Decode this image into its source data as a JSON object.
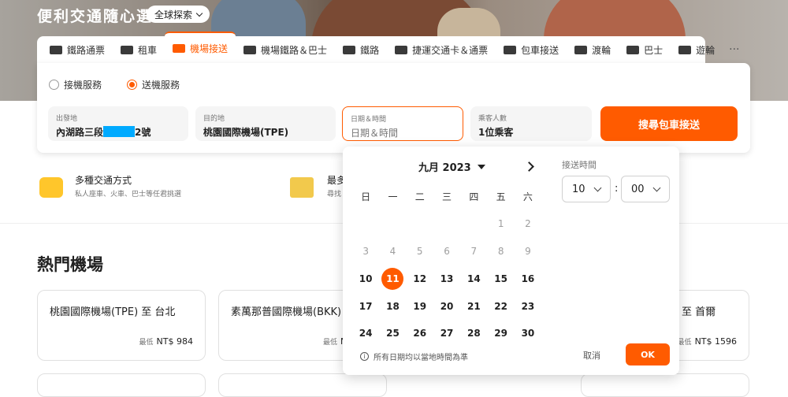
{
  "header": {
    "title": "便利交通隨心選",
    "explore_label": "全球探索"
  },
  "tabs": [
    {
      "label": "鐵路通票",
      "icon": "train-icon"
    },
    {
      "label": "租車",
      "icon": "car-icon"
    },
    {
      "label": "機場接送",
      "icon": "airport-transfer-icon",
      "active": true
    },
    {
      "label": "機場鐵路＆巴士",
      "icon": "airport-rail-icon"
    },
    {
      "label": "鐵路",
      "icon": "rail-icon"
    },
    {
      "label": "捷運交通卡＆通票",
      "icon": "metro-card-icon"
    },
    {
      "label": "包車接送",
      "icon": "charter-icon"
    },
    {
      "label": "渡輪",
      "icon": "ferry-icon"
    },
    {
      "label": "巴士",
      "icon": "bus-icon"
    },
    {
      "label": "遊輪",
      "icon": "cruise-icon"
    },
    {
      "label": "···",
      "icon": "more-icon"
    }
  ],
  "search": {
    "pickup_label": "接機服務",
    "dropoff_label": "送機服務",
    "selected_service": "送機服務",
    "from_label": "出發地",
    "from_value_prefix": "內湖路三段",
    "from_value_suffix": "2號",
    "to_label": "目的地",
    "to_value": "桃園國際機場(TPE)",
    "datetime_label": "日期＆時間",
    "datetime_placeholder": "日期＆時間",
    "passengers_label": "乘客人數",
    "passengers_value": "1位乘客",
    "search_button": "搜尋包車接送"
  },
  "features": [
    {
      "title": "多種交通方式",
      "subtitle": "私人座車、火車、巴士等任君挑選"
    },
    {
      "title": "最多",
      "subtitle": "尋找"
    }
  ],
  "popular": {
    "title": "熱門機場",
    "cards": [
      {
        "title": "桃園國際機場(TPE) 至 台北",
        "min_label": "最低",
        "price": "NT$ 984"
      },
      {
        "title": "素萬那普國際機場(BKK) 至",
        "min_label": "最低",
        "price": "N"
      },
      {
        "title": "至 首爾",
        "min_label": "最低",
        "price": "NT$ 1596"
      }
    ]
  },
  "calendar": {
    "month_label": "九月 2023",
    "weekdays": [
      "日",
      "一",
      "二",
      "三",
      "四",
      "五",
      "六"
    ],
    "leading_blanks": 5,
    "days": [
      "1",
      "2",
      "3",
      "4",
      "5",
      "6",
      "7",
      "8",
      "9",
      "10",
      "11",
      "12",
      "13",
      "14",
      "15",
      "16",
      "17",
      "18",
      "19",
      "20",
      "21",
      "22",
      "23",
      "24",
      "25",
      "26",
      "27",
      "28",
      "29",
      "30"
    ],
    "disabled_through": 9,
    "selected_day": "11",
    "time_label": "接送時間",
    "hour": "10",
    "minute": "00",
    "note": "所有日期均以當地時間為準",
    "cancel_label": "取消",
    "ok_label": "OK"
  },
  "colors": {
    "accent": "#ff5b00"
  }
}
